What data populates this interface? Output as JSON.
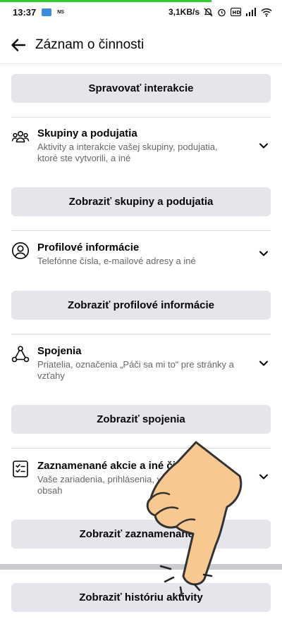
{
  "status": {
    "time": "13:37",
    "small_text": "NS",
    "speed": "3,1KB/s"
  },
  "header": {
    "title": "Záznam o činnosti"
  },
  "buttons": {
    "manage_interactions": "Spravovať interakcie",
    "groups": "Zobraziť skupiny a podujatia",
    "profile": "Zobraziť profilové informácie",
    "connections": "Zobraziť spojenia",
    "logged": "Zobraziť zaznamenané a",
    "history": "Zobraziť históriu aktivity"
  },
  "sections": [
    {
      "title": "Skupiny a podujatia",
      "desc": "Aktivity a interakcie vašej skupiny, podujatia, ktoré ste vytvorili, a iné",
      "icon": "groups-icon"
    },
    {
      "title": "Profilové informácie",
      "desc": "Telefónne čísla, e-mailové adresy a iné",
      "icon": "profile-icon"
    },
    {
      "title": "Spojenia",
      "desc": "Priatelia, označenia „Páči sa mi to“ pre stránky a vzťahy",
      "icon": "connections-icon"
    },
    {
      "title": "Zaznamenané akcie a iné či",
      "desc": "Vaše zariadenia, prihlásenia, v pozerali, a ďalší obsah",
      "icon": "checklist-icon"
    }
  ],
  "colors": {
    "button_bg": "#e4e6eb",
    "secondary_text": "#65676b",
    "hand_fill": "#f7c88f"
  }
}
